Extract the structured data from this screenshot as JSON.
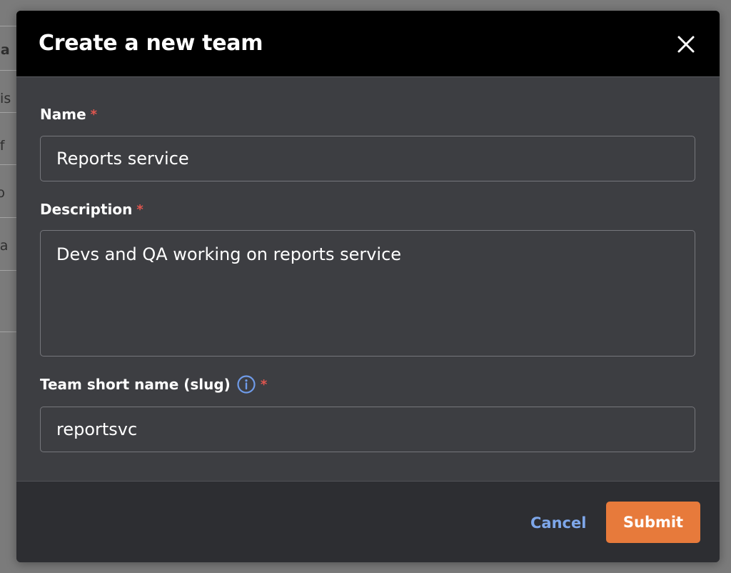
{
  "background": {
    "fragments": [
      "ea",
      "pis",
      "ef",
      "ro",
      "ea"
    ]
  },
  "modal": {
    "title": "Create a new team",
    "close_icon": "close-icon",
    "fields": {
      "name": {
        "label": "Name",
        "required_marker": "*",
        "value": "Reports service"
      },
      "description": {
        "label": "Description",
        "required_marker": "*",
        "value": "Devs and QA working on reports service"
      },
      "slug": {
        "label": "Team short name (slug)",
        "info_icon": "info-icon",
        "required_marker": "*",
        "value": "reportsvc"
      }
    },
    "footer": {
      "cancel_label": "Cancel",
      "submit_label": "Submit"
    }
  },
  "colors": {
    "header_bg": "#000000",
    "modal_bg": "#3d3e42",
    "footer_bg": "#2d2e32",
    "required": "#e2564f",
    "link": "#7ea7ea",
    "info_icon": "#6f9be8",
    "submit_bg": "#e77a3b"
  }
}
